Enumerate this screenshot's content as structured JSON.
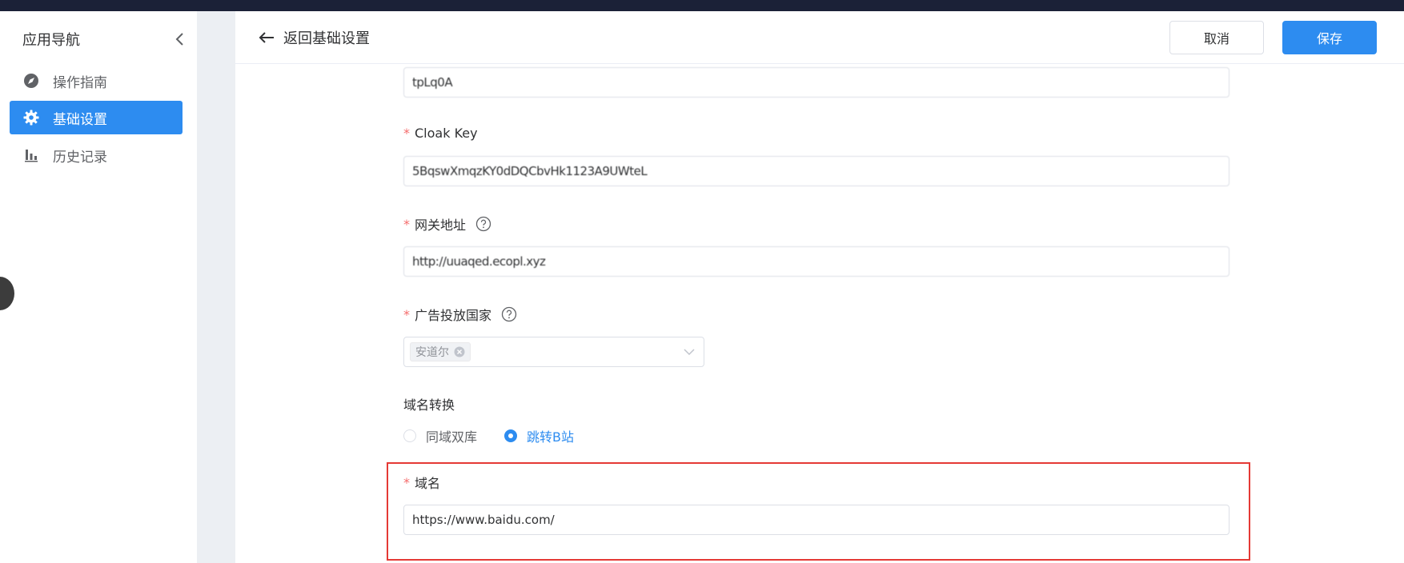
{
  "sidebar": {
    "title": "应用导航",
    "collapse_icon": "chevron-left-icon",
    "items": [
      {
        "label": "操作指南",
        "icon": "compass-icon",
        "active": false
      },
      {
        "label": "基础设置",
        "icon": "gear-icon",
        "active": true
      },
      {
        "label": "历史记录",
        "icon": "bar-chart-icon",
        "active": false
      }
    ]
  },
  "header": {
    "back_label": "返回基础设置",
    "cancel_label": "取消",
    "save_label": "保存"
  },
  "form": {
    "field1_value": "tpLq0A",
    "cloak_key": {
      "label": "Cloak Key",
      "value": "5BqswXmqzKY0dDQCbvHk1123A9UWteL"
    },
    "gateway": {
      "label": "网关地址",
      "value": "http://uuaqed.ecopl.xyz"
    },
    "country": {
      "label": "广告投放国家",
      "tag": "安道尔"
    },
    "domain_switch": {
      "label": "域名转换",
      "options": [
        {
          "label": "同域双库",
          "checked": false
        },
        {
          "label": "跳转B站",
          "checked": true
        }
      ]
    },
    "domain": {
      "label": "域名",
      "value": "https://www.baidu.com/"
    }
  },
  "colors": {
    "accent": "#2d8cf0",
    "required": "#f56c6c",
    "highlight": "#e53935",
    "topbar": "#1b2137"
  }
}
